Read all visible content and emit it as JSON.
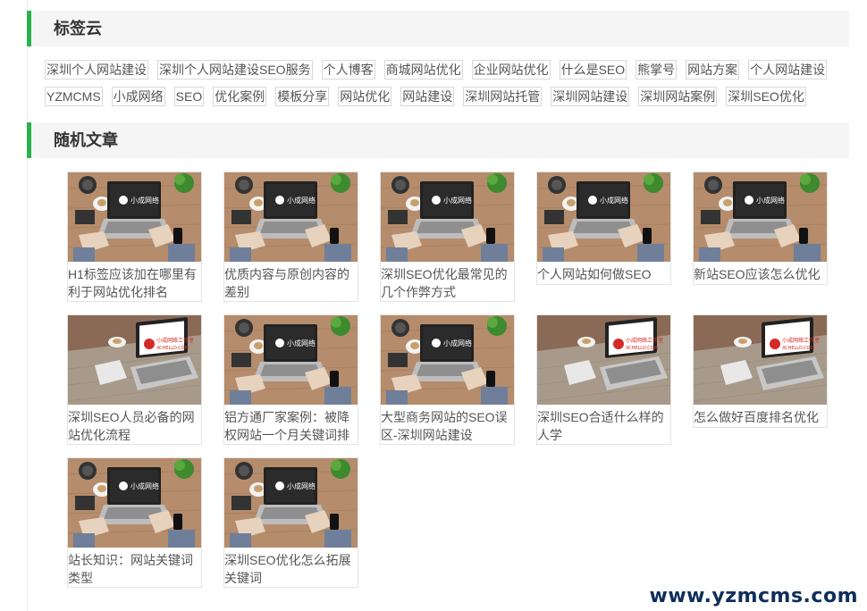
{
  "sections": {
    "tag_cloud_title": "标签云",
    "random_title": "随机文章"
  },
  "tags": [
    [
      "深圳个人网站建设",
      "深圳个人网站建设SEO服务",
      "个人博客",
      "商城网站优化",
      "企业网站优化",
      "什么是SEO",
      "熊掌号",
      "网站方案",
      "个人网站建设"
    ],
    [
      "YZMCMS",
      "小成网络",
      "SEO",
      "优化案例",
      "模板分享",
      "网站优化",
      "网站建设",
      "深圳网站托管",
      "深圳网站建设",
      "深圳网站案例",
      "深圳SEO优化"
    ]
  ],
  "articles": [
    {
      "title": "H1标签应该加在哪里有利于网站优化排名",
      "image": "desk-logo"
    },
    {
      "title": "优质内容与原创内容的差别",
      "image": "desk-logo"
    },
    {
      "title": "深圳SEO优化最常见的几个作弊方式",
      "image": "desk-logo"
    },
    {
      "title": "个人网站如何做SEO",
      "image": "desk-logo"
    },
    {
      "title": "新站SEO应该怎么优化",
      "image": "desk-logo"
    },
    {
      "title": "深圳SEO人员必备的网站优化流程",
      "image": "desk-studio"
    },
    {
      "title": "铝方通厂家案例：被降权网站一个月关键词排名冲上百度",
      "image": "desk-logo"
    },
    {
      "title": "大型商务网站的SEO误区-深圳网站建设",
      "image": "desk-logo"
    },
    {
      "title": "深圳SEO合适什么样的人学",
      "image": "desk-studio"
    },
    {
      "title": "怎么做好百度排名优化",
      "image": "desk-studio"
    },
    {
      "title": "站长知识：网站关键词类型",
      "image": "desk-logo"
    },
    {
      "title": "深圳SEO优化怎么拓展关键词",
      "image": "desk-logo"
    }
  ],
  "thumb_text": {
    "logo": "小成网络",
    "studio": "小成网络工作室",
    "studio_url": "XCHELLO.COM"
  },
  "watermark": "www.yzmcms.com",
  "colors": {
    "accent": "#2bb24c",
    "head_bg": "#f5f5f5",
    "watermark": "#0f2f5a"
  }
}
